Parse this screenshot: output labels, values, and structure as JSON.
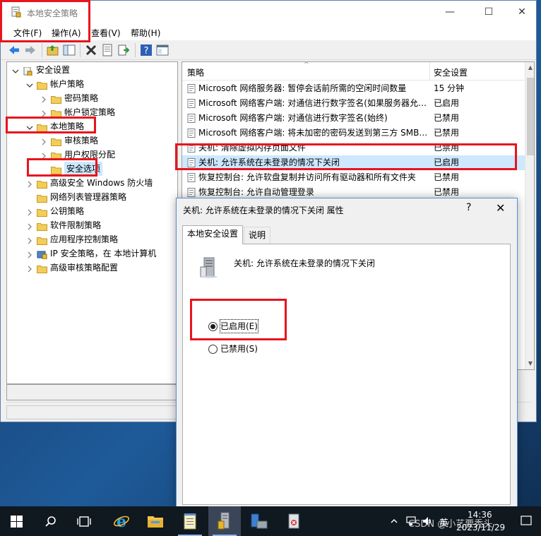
{
  "window": {
    "title": "本地安全策略",
    "controls": {
      "minimize": "—",
      "maximize": "☐",
      "close": "✕"
    }
  },
  "menu": [
    {
      "label": "文件(F)"
    },
    {
      "label": "操作(A)"
    },
    {
      "label": "查看(V)"
    },
    {
      "label": "帮助(H)"
    }
  ],
  "toolbar": {
    "icons": [
      "back-arrow-icon",
      "forward-arrow-icon",
      "up-folder-icon",
      "show-tree-icon",
      "delete-icon",
      "properties-icon",
      "export-list-icon",
      "help-icon",
      "details-icon"
    ]
  },
  "tree": {
    "items": [
      {
        "label": "安全设置",
        "expander": "⌄",
        "icon": "security-settings-icon",
        "selected": false
      },
      {
        "label": "帐户策略",
        "expander": "⌄",
        "icon": "folder-icon",
        "selected": false
      },
      {
        "label": "密码策略",
        "expander": "›",
        "icon": "folder-icon",
        "selected": false
      },
      {
        "label": "帐户锁定策略",
        "expander": "›",
        "icon": "folder-icon",
        "selected": false
      },
      {
        "label": "本地策略",
        "expander": "⌄",
        "icon": "folder-icon",
        "selected": false
      },
      {
        "label": "审核策略",
        "expander": "›",
        "icon": "folder-icon",
        "selected": false
      },
      {
        "label": "用户权限分配",
        "expander": "›",
        "icon": "folder-icon",
        "selected": false
      },
      {
        "label": "安全选项",
        "expander": "",
        "icon": "folder-icon",
        "selected": true
      },
      {
        "label": "高级安全 Windows 防火墙",
        "expander": "›",
        "icon": "firewall-folder-icon",
        "selected": false
      },
      {
        "label": "网络列表管理器策略",
        "expander": "",
        "icon": "folder-icon",
        "selected": false
      },
      {
        "label": "公钥策略",
        "expander": "›",
        "icon": "folder-icon",
        "selected": false
      },
      {
        "label": "软件限制策略",
        "expander": "›",
        "icon": "folder-icon",
        "selected": false
      },
      {
        "label": "应用程序控制策略",
        "expander": "›",
        "icon": "folder-icon",
        "selected": false
      },
      {
        "label": "IP 安全策略，在 本地计算机",
        "expander": "›",
        "icon": "ip-security-icon",
        "selected": false
      },
      {
        "label": "高级审核策略配置",
        "expander": "›",
        "icon": "folder-icon",
        "selected": false
      }
    ]
  },
  "list": {
    "headers": {
      "policy": "策略",
      "setting": "安全设置"
    },
    "rows": [
      {
        "name": "Microsoft 网络服务器: 暂停会话前所需的空闲时间数量",
        "value": "15 分钟",
        "selected": false
      },
      {
        "name": "Microsoft 网络客户端: 对通信进行数字签名(如果服务器允…",
        "value": "已启用",
        "selected": false
      },
      {
        "name": "Microsoft 网络客户端: 对通信进行数字签名(始终)",
        "value": "已禁用",
        "selected": false
      },
      {
        "name": "Microsoft 网络客户端: 将未加密的密码发送到第三方 SMB…",
        "value": "已禁用",
        "selected": false
      },
      {
        "name": "关机: 清除虚拟内存页面文件",
        "value": "已禁用",
        "selected": false
      },
      {
        "name": "关机: 允许系统在未登录的情况下关闭",
        "value": "已启用",
        "selected": true
      },
      {
        "name": "恢复控制台: 允许软盘复制并访问所有驱动器和所有文件夹",
        "value": "已禁用",
        "selected": false
      },
      {
        "name": "恢复控制台: 允许自动管理登录",
        "value": "已禁用",
        "selected": false
      }
    ]
  },
  "dialog": {
    "title": "关机: 允许系统在未登录的情况下关闭 属性",
    "help": "?",
    "close": "✕",
    "tabs": [
      {
        "label": "本地安全设置",
        "active": true
      },
      {
        "label": "说明",
        "active": false
      }
    ],
    "policy_name": "关机: 允许系统在未登录的情况下关闭",
    "options": [
      {
        "label": "已启用(E)",
        "checked": true
      },
      {
        "label": "已禁用(S)",
        "checked": false
      }
    ]
  },
  "taskbar": {
    "apps": [
      "windows-start-icon",
      "search-icon",
      "task-view-icon",
      "internet-explorer-icon",
      "file-explorer-icon",
      "notepad-icon",
      "local-security-policy-icon",
      "server-manager-icon",
      "system-tool-icon"
    ],
    "tray": {
      "ime": "英",
      "watermark": "CSDN @小艺要秃头",
      "time": "14:36",
      "date": "2023/11/29"
    }
  },
  "colors": {
    "annotation": "#e8141e",
    "selection": "#cde8ff",
    "taskbar": "#101820"
  }
}
